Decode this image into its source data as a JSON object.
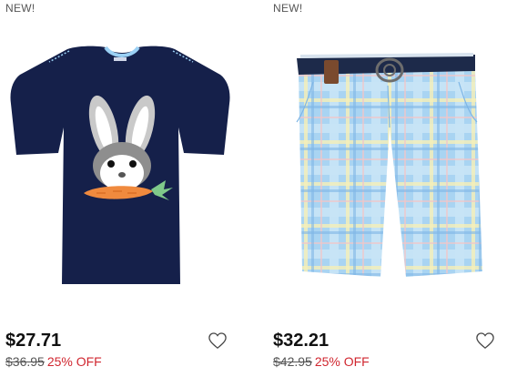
{
  "products": [
    {
      "badge": "NEW!",
      "price": "$27.71",
      "original_price": "$36.95",
      "discount": "25% OFF",
      "image_icon": "bunny-carrot-tshirt"
    },
    {
      "badge": "NEW!",
      "price": "$32.21",
      "original_price": "$42.95",
      "discount": "25% OFF",
      "image_icon": "plaid-shorts-with-belt"
    }
  ],
  "colors": {
    "discount": "#d0262f",
    "shirt": "#15204a",
    "plaid_base": "#a9d4f2"
  },
  "icons": {
    "wishlist": "heart-outline-icon"
  }
}
